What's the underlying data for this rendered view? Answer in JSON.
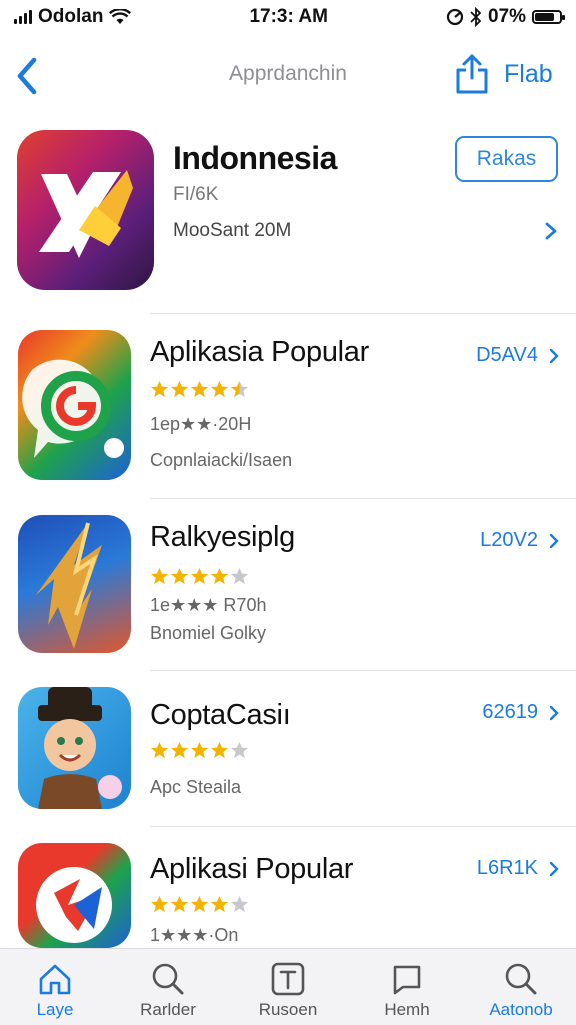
{
  "status": {
    "carrier": "Odolan",
    "time": "17:3: AM",
    "battery": "07%",
    "battery_level": 0.8
  },
  "nav": {
    "title": "Apprdanchin",
    "action": "Flab"
  },
  "hero": {
    "title": "Indonnesia",
    "subtitle": "FI/6K",
    "meta": "MooSant 20M",
    "button": "Rakas"
  },
  "rows": [
    {
      "title": "Aplikasia Popular",
      "rating": 4.5,
      "line1": "1ep★★·20H",
      "line2": "Copnlaiacki/Isaen",
      "link": "D5AV4"
    },
    {
      "title": "Ralkyesiplg",
      "rating": 4,
      "line1": "1e★★★ R70h",
      "line2": "Bnomiel Golky",
      "link": "L20V2"
    },
    {
      "title": "CoptaCasiı",
      "rating": 4,
      "line1": "",
      "line2": "Apc Steaila",
      "link": "62619"
    },
    {
      "title": "Aplikasi Popular",
      "rating": 4,
      "line1": "1★★★·On",
      "line2": "",
      "link": "L6R1K"
    }
  ],
  "tabs": [
    {
      "label": "Laye",
      "icon": "home-icon",
      "active": true
    },
    {
      "label": "Rarlder",
      "icon": "search-icon",
      "active": false
    },
    {
      "label": "Rusoen",
      "icon": "text-icon",
      "active": false
    },
    {
      "label": "Hemh",
      "icon": "chat-icon",
      "active": false
    },
    {
      "label": "Aatonob",
      "icon": "search-icon",
      "active": true
    }
  ],
  "colors": {
    "accent": "#1a7be0",
    "star": "#f5b301",
    "star_empty": "#c7c7cc"
  }
}
